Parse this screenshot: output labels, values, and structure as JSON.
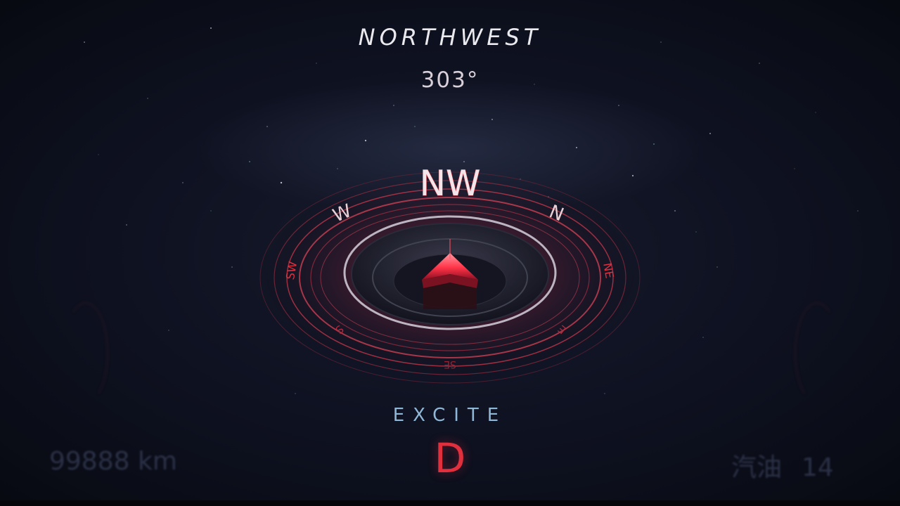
{
  "heading": {
    "direction_name": "NORTHWEST",
    "bearing": "303°"
  },
  "compass": {
    "primary_label": "NW",
    "ring_labels": {
      "w": "W",
      "n": "N",
      "sw": "SW",
      "ne": "NE",
      "s": "S",
      "e": "E",
      "se": "SE"
    },
    "accent_color": "#e0303e",
    "ring_color": "#b8324a"
  },
  "drive": {
    "mode": "EXCITE",
    "gear": "D"
  },
  "odometer": {
    "value": "99888 km"
  },
  "fuel": {
    "label": "汽油",
    "value": "14"
  },
  "icons": {
    "heading_arrow": "navigation-arrow-icon"
  }
}
